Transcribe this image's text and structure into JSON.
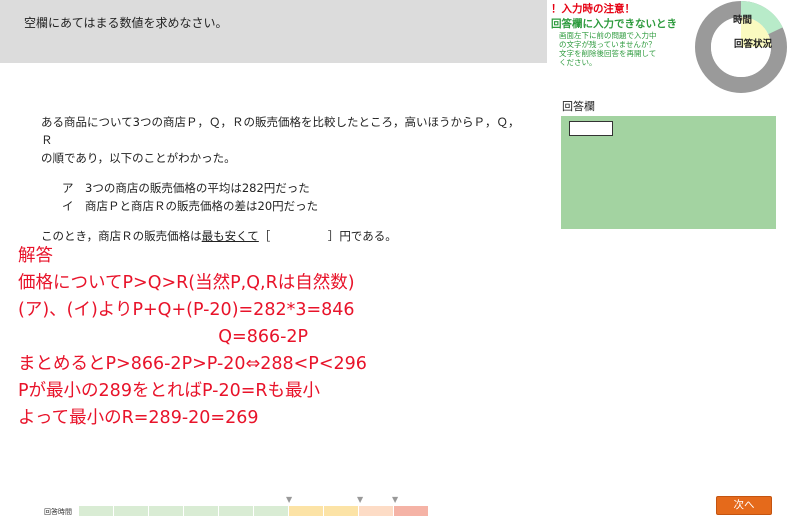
{
  "header": {
    "instruction": "空欄にあてはまる数値を求めなさい。"
  },
  "notice": {
    "title": "！入力時の注意！",
    "heading": "回答欄に入力できないとき",
    "body_lines": [
      "画面左下に前の問題で入力中",
      "の文字が残っていませんか？",
      "文字を削除後回答を再開して",
      "ください。"
    ]
  },
  "timer": {
    "time_label": "時間",
    "status_label": "回答状況",
    "time_fraction": 0.18,
    "colors": {
      "ring": "#9a9a9a",
      "time": "#b8ebc9",
      "status": "#fafac0"
    }
  },
  "question": {
    "line1": "ある商品について3つの商店Ｐ，Ｑ，Ｒの販売価格を比較したところ，高いほうからＰ，Ｑ，Ｒ",
    "line2": "の順であり，以下のことがわかった。",
    "cond_a": "ア　3つの商店の販売価格の平均は282円だった",
    "cond_i": "イ　商店Ｐと商店Ｒの販売価格の差は20円だった",
    "ask_prefix": "このとき，商店Ｒの販売価格は",
    "ask_underlined": "最も安くて",
    "ask_bracket": "［　　　　　］",
    "ask_suffix": "円である。"
  },
  "answer": {
    "label": "回答欄",
    "value": ""
  },
  "solution": {
    "lines": [
      "解答",
      "価格についてP>Q>R(当然P,Q,Rは自然数)",
      "(ア)、(イ)よりP+Q+(P-20)=282*3=846",
      "                                    Q=866-2P",
      "まとめるとP>866-2P>P-20⇔288<P<296",
      "Pが最小の289をとればP-20=Rも最小",
      "よって最小のR=289-20=269"
    ]
  },
  "footer": {
    "time_label": "回答時間",
    "segments": [
      "#d9ecd4",
      "#d9ecd4",
      "#d9ecd4",
      "#d9ecd4",
      "#d9ecd4",
      "#d9ecd4",
      "#fce3a6",
      "#fce3a6",
      "#fddcc6",
      "#f5b3a6"
    ],
    "next_label": "次へ"
  }
}
